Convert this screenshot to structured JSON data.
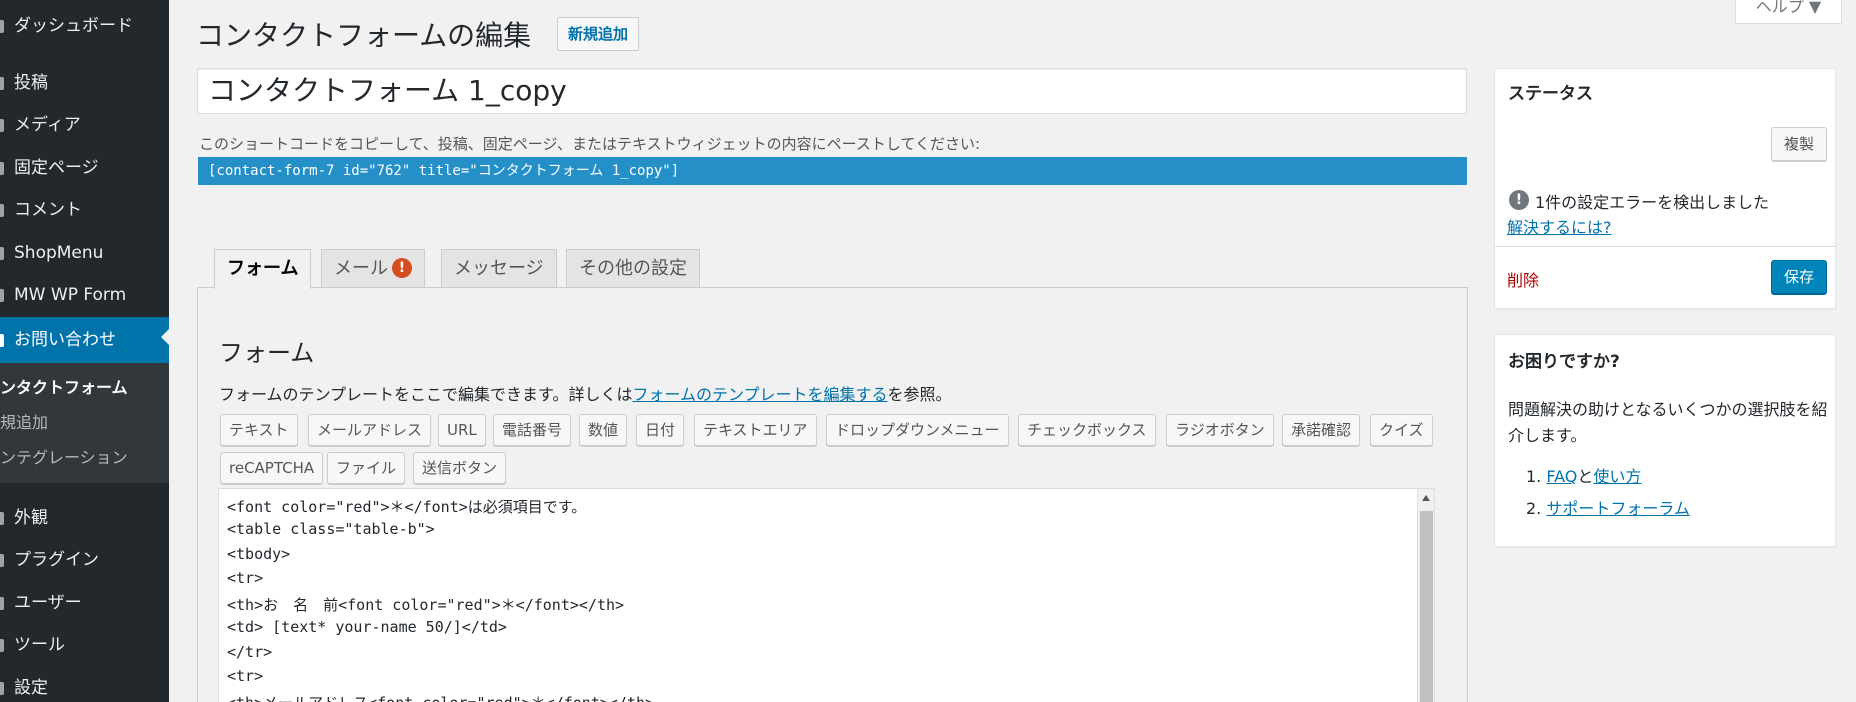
{
  "sidebar": {
    "items": [
      {
        "label": "ダッシュボード"
      },
      {
        "label": "投稿"
      },
      {
        "label": "メディア"
      },
      {
        "label": "固定ページ"
      },
      {
        "label": "コメント"
      },
      {
        "label": "ShopMenu"
      },
      {
        "label": "MW WP Form"
      },
      {
        "label": "お問い合わせ"
      },
      {
        "label": "外観"
      },
      {
        "label": "プラグイン"
      },
      {
        "label": "ユーザー"
      },
      {
        "label": "ツール"
      },
      {
        "label": "設定"
      }
    ],
    "submenu": [
      {
        "label": "ンタクトフォーム"
      },
      {
        "label": "規追加"
      },
      {
        "label": "ンテグレーション"
      }
    ]
  },
  "header": {
    "title": "コンタクトフォームの編集",
    "add_new": "新規追加",
    "help": "ヘルプ ▼"
  },
  "form": {
    "title_value": "コンタクトフォーム 1_copy",
    "shortcode_desc": "このショートコードをコピーして、投稿、固定ページ、またはテキストウィジェットの内容にペーストしてください:",
    "shortcode": "[contact-form-7 id=\"762\" title=\"コンタクトフォーム 1_copy\"]"
  },
  "tabs": [
    {
      "label": "フォーム"
    },
    {
      "label": "メール",
      "badge": "!"
    },
    {
      "label": "メッセージ"
    },
    {
      "label": "その他の設定"
    }
  ],
  "panel": {
    "title": "フォーム",
    "desc_prefix": "フォームのテンプレートをここで編集できます。詳しくは",
    "desc_link": "フォームのテンプレートを編集する",
    "desc_suffix": "を参照。",
    "tag_buttons": [
      "テキスト",
      "メールアドレス",
      "URL",
      "電話番号",
      "数値",
      "日付",
      "テキストエリア",
      "ドロップダウンメニュー",
      "チェックボックス",
      "ラジオボタン",
      "承諾確認",
      "クイズ",
      "reCAPTCHA",
      "ファイル",
      "送信ボタン"
    ],
    "code_lines": [
      "<font color=\"red\">＊</font>は必須項目です。",
      "<table class=\"table-b\">",
      "<tbody>",
      "<tr>",
      "<th>お　名　前<font color=\"red\">＊</font></th>",
      "<td> [text* your-name 50/]</td>",
      "</tr>",
      "<tr>",
      "<th>メールアドレス<font color=\"red\">＊</font></th>"
    ]
  },
  "status_box": {
    "title": "ステータス",
    "duplicate": "複製",
    "warning_icon": "!",
    "warning": "1件の設定エラーを検出しました",
    "resolve_link": "解決するには?",
    "delete": "削除",
    "save": "保存"
  },
  "help_box": {
    "title": "お困りですか?",
    "desc": "問題解決の助けとなるいくつかの選択肢を紹介します。",
    "item1_num": "1.",
    "item1_link_a": "FAQ",
    "item1_mid": "と",
    "item1_link_b": "使い方",
    "item2_num": "2.",
    "item2_link": "サポートフォーラム"
  }
}
